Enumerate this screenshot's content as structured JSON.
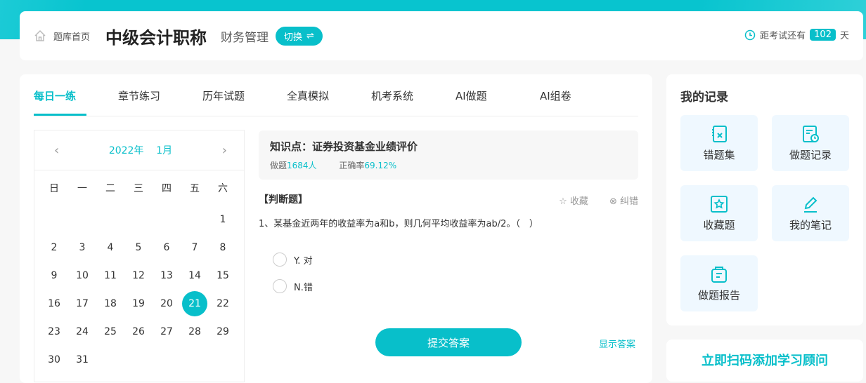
{
  "header": {
    "home": "题库首页",
    "title": "中级会计职称",
    "subject": "财务管理",
    "switch": "切换",
    "countdown_label": "距考试还有",
    "days": "102",
    "days_unit": "天"
  },
  "tabs": [
    "每日一练",
    "章节练习",
    "历年试题",
    "全真模拟",
    "机考系统",
    "AI做题",
    "AI组卷"
  ],
  "calendar": {
    "year": "2022年",
    "month": "1月",
    "weekdays": [
      "日",
      "一",
      "二",
      "三",
      "四",
      "五",
      "六"
    ],
    "selected": 21,
    "first_weekday": 6,
    "days_in_month": 31
  },
  "knowledge": {
    "title": "知识点：证券投资基金业绩评价",
    "done_label": "做题",
    "done_count": "1684人",
    "rate_label": "正确率",
    "rate": "69.12%"
  },
  "question": {
    "type": "【判断题】",
    "favorite": "收藏",
    "report": "纠错",
    "text": "1、某基金近两年的收益率为a和b，则几何平均收益率为ab/2。（　）",
    "options": [
      "Y. 对",
      "N.错"
    ],
    "submit": "提交答案",
    "show_answer": "显示答案"
  },
  "records": {
    "title": "我的记录",
    "items": [
      "错题集",
      "做题记录",
      "收藏题",
      "我的笔记",
      "做题报告"
    ]
  },
  "promo": {
    "title": "立即扫码添加学习顾问"
  },
  "colors": {
    "accent": "#08bfca"
  }
}
